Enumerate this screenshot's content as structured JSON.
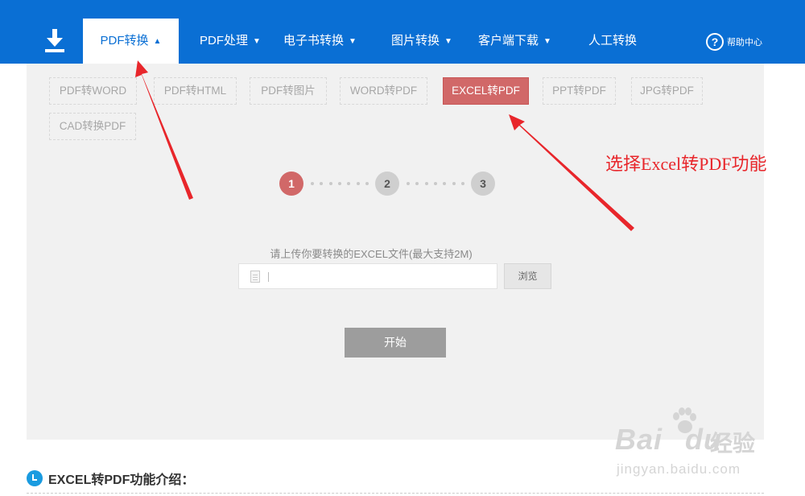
{
  "nav": {
    "download_icon": "download-icon",
    "items": [
      {
        "label": "PDF转换",
        "caret": "▲",
        "active": true
      },
      {
        "label": "PDF处理",
        "caret": "▼"
      },
      {
        "label": "电子书转换",
        "caret": "▼"
      },
      {
        "label": "图片转换",
        "caret": "▼"
      },
      {
        "label": "客户端下载",
        "caret": "▼"
      },
      {
        "label": "人工转换",
        "caret": ""
      }
    ],
    "help": {
      "icon_glyph": "?",
      "label": "帮助中心"
    }
  },
  "options": [
    {
      "label": "PDF转WORD"
    },
    {
      "label": "PDF转HTML"
    },
    {
      "label": "PDF转图片"
    },
    {
      "label": "WORD转PDF"
    },
    {
      "label": "EXCEL转PDF",
      "active": true
    },
    {
      "label": "PPT转PDF"
    },
    {
      "label": "JPG转PDF"
    },
    {
      "label": "CAD转换PDF"
    }
  ],
  "steps": [
    "1",
    "2",
    "3"
  ],
  "active_step": "1",
  "upload": {
    "hint": "请上传你要转换的EXCEL文件(最大支持2M)",
    "file_value": "",
    "browse_label": "浏览",
    "start_label": "开始"
  },
  "annotation": "选择Excel转PDF功能",
  "intro_heading": "EXCEL转PDF功能介绍：",
  "watermark": {
    "logo": "Bai",
    "logo2": "du",
    "cn": "经验",
    "url": "jingyan.baidu.com"
  },
  "colors": {
    "nav_bg": "#0a6fd4",
    "active_option": "#d16868",
    "annotation": "#e8262b",
    "panel_bg": "#f1f1f1"
  }
}
